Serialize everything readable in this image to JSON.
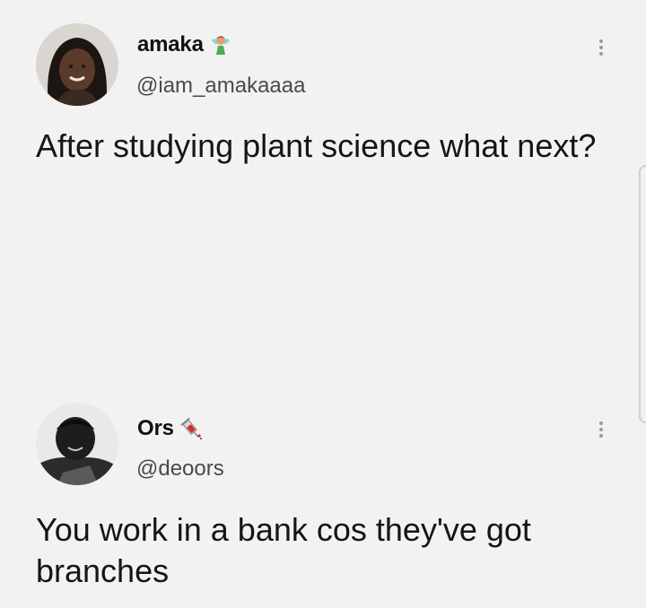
{
  "tweets": [
    {
      "display_name": "amaka",
      "name_emoji": "fairy-emoji",
      "handle": "@iam_amakaaaa",
      "text": "After studying plant science what next?"
    },
    {
      "display_name": "Ors",
      "name_emoji": "syringe-emoji",
      "handle": "@deoors",
      "text": "You work in a bank cos they've got branches"
    }
  ],
  "colors": {
    "background": "#f2f2f2",
    "text": "#151515",
    "handle": "#4a4a4a",
    "menu_dots": "#9a9a9a"
  }
}
